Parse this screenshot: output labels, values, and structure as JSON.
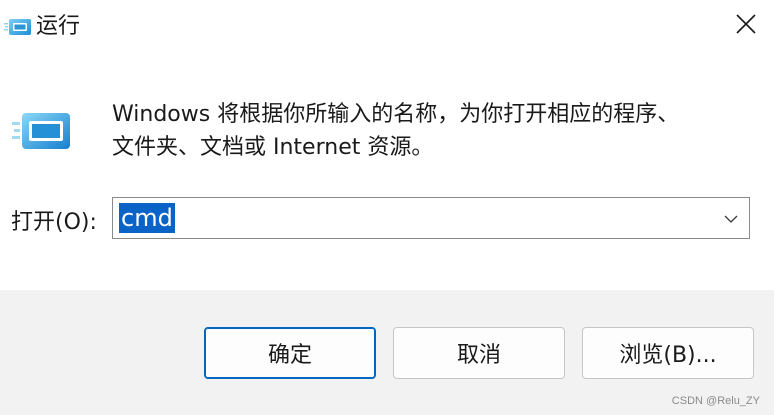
{
  "window": {
    "title": "运行",
    "icon": "run-icon",
    "close_icon": "close-icon"
  },
  "description": "Windows 将根据你所输入的名称，为你打开相应的程序、\n文件夹、文档或 Internet 资源。",
  "open_field": {
    "label": "打开(O):",
    "value": "cmd",
    "selected": true,
    "dropdown_icon": "chevron-down-icon"
  },
  "buttons": {
    "ok": "确定",
    "cancel": "取消",
    "browse": "浏览(B)..."
  },
  "watermark": "CSDN @Relu_ZY",
  "colors": {
    "accent": "#0067c0",
    "selection": "#0a64c8",
    "footer_bg": "#f2f2f2"
  }
}
